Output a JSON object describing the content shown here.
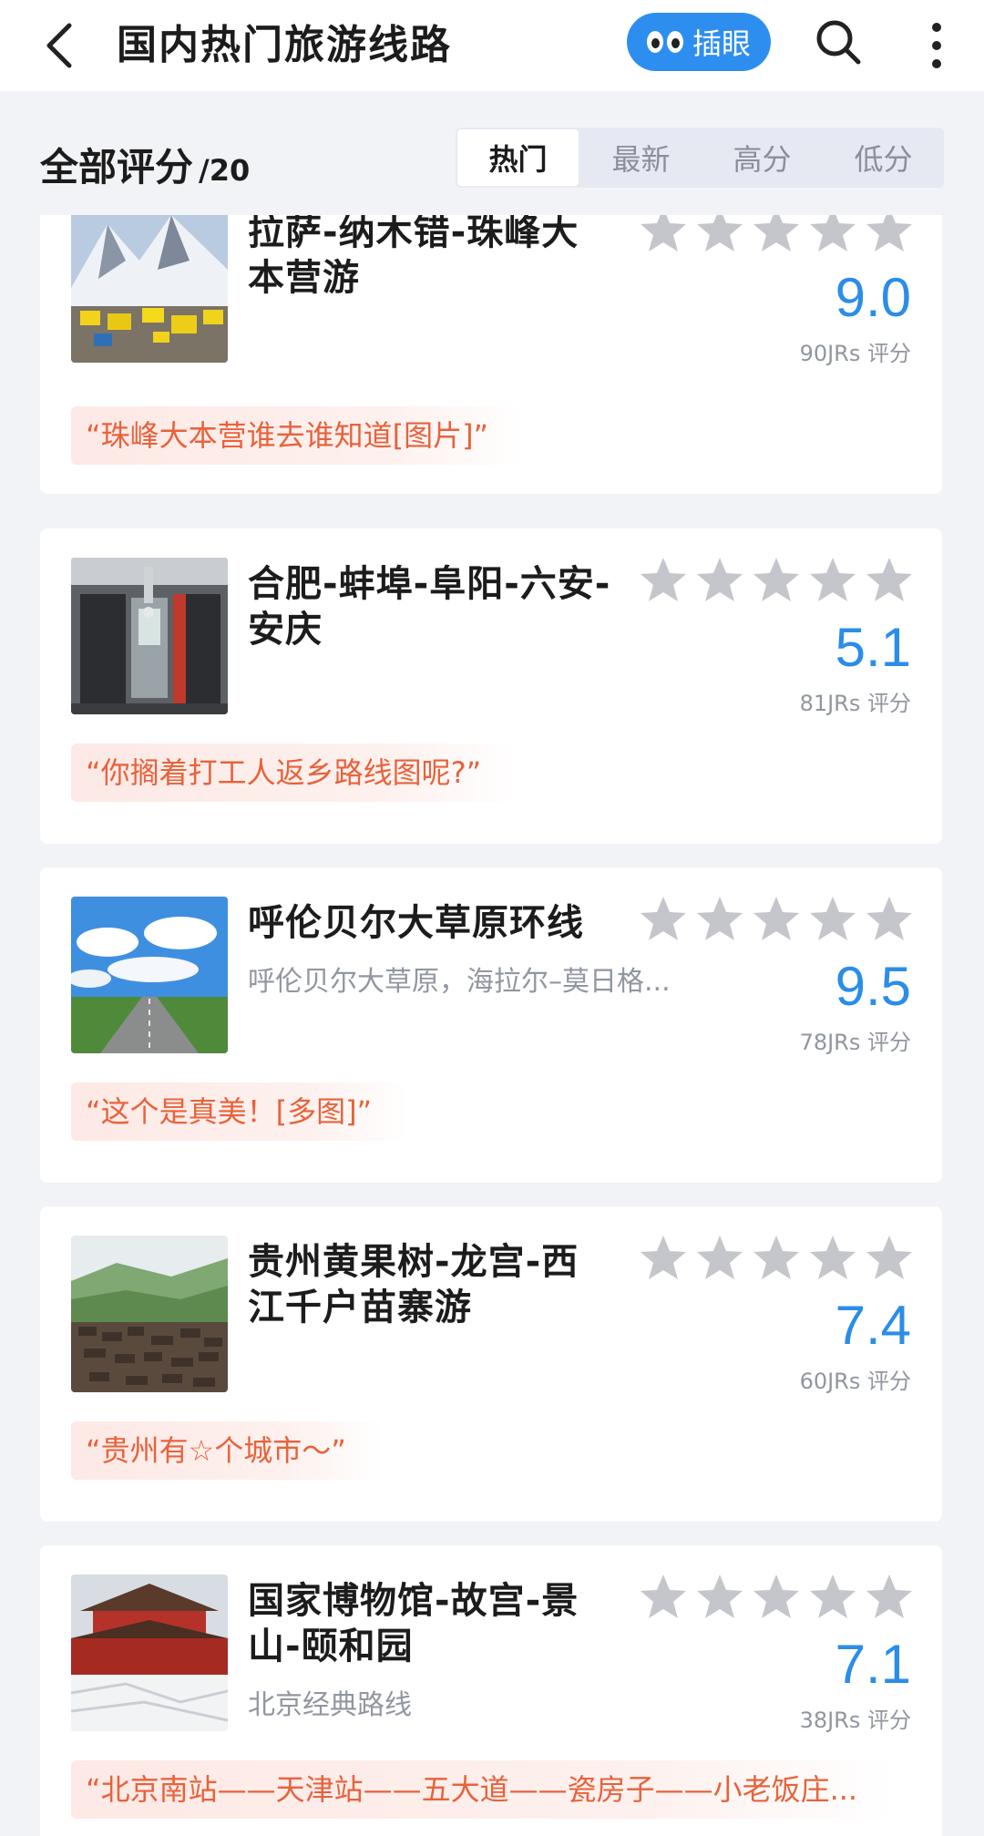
{
  "header": {
    "title": "国内热门旅游线路",
    "peek_label": "插眼"
  },
  "sort": {
    "all_label": "全部评分",
    "count": "/20",
    "tabs": [
      "热门",
      "最新",
      "高分",
      "低分"
    ],
    "active_tab": "热门"
  },
  "colors": {
    "accent": "#2b8de8",
    "quote_text": "#e8623b",
    "star_gray": "#c4c6cc"
  },
  "cards": [
    {
      "title": "拉萨-纳木错-珠峰大本营游",
      "subtitle": "",
      "score": "9.0",
      "votes": "90JRs 评分",
      "quote": "“珠峰大本营谁去谁知道[图片]”",
      "image": "everest-base-camp-tents-photo"
    },
    {
      "title": "合肥-蚌埠-阜阳-六安-安庆",
      "subtitle": "",
      "score": "5.1",
      "votes": "81JRs 评分",
      "quote": "“你搁着打工人返乡路线图呢?”",
      "image": "train-carriage-photo"
    },
    {
      "title": "呼伦贝尔大草原环线",
      "subtitle": "呼伦贝尔大草原，海拉尔–莫日格...",
      "score": "9.5",
      "votes": "78JRs 评分",
      "quote": "“这个是真美！[多图]”",
      "image": "grassland-road-photo"
    },
    {
      "title": "贵州黄果树-龙宫-西江千户苗寨游",
      "subtitle": "",
      "score": "7.4",
      "votes": "60JRs 评分",
      "quote": "“贵州有☆个城市～”",
      "image": "miao-village-photo"
    },
    {
      "title": "国家博物馆-故宫-景山-颐和园",
      "subtitle": "北京经典路线",
      "score": "7.1",
      "votes": "38JRs 评分",
      "quote": "“北京南站——天津站——五大道——瓷房子——小老饭庄...",
      "image": "forbidden-city-snow-photo"
    }
  ]
}
